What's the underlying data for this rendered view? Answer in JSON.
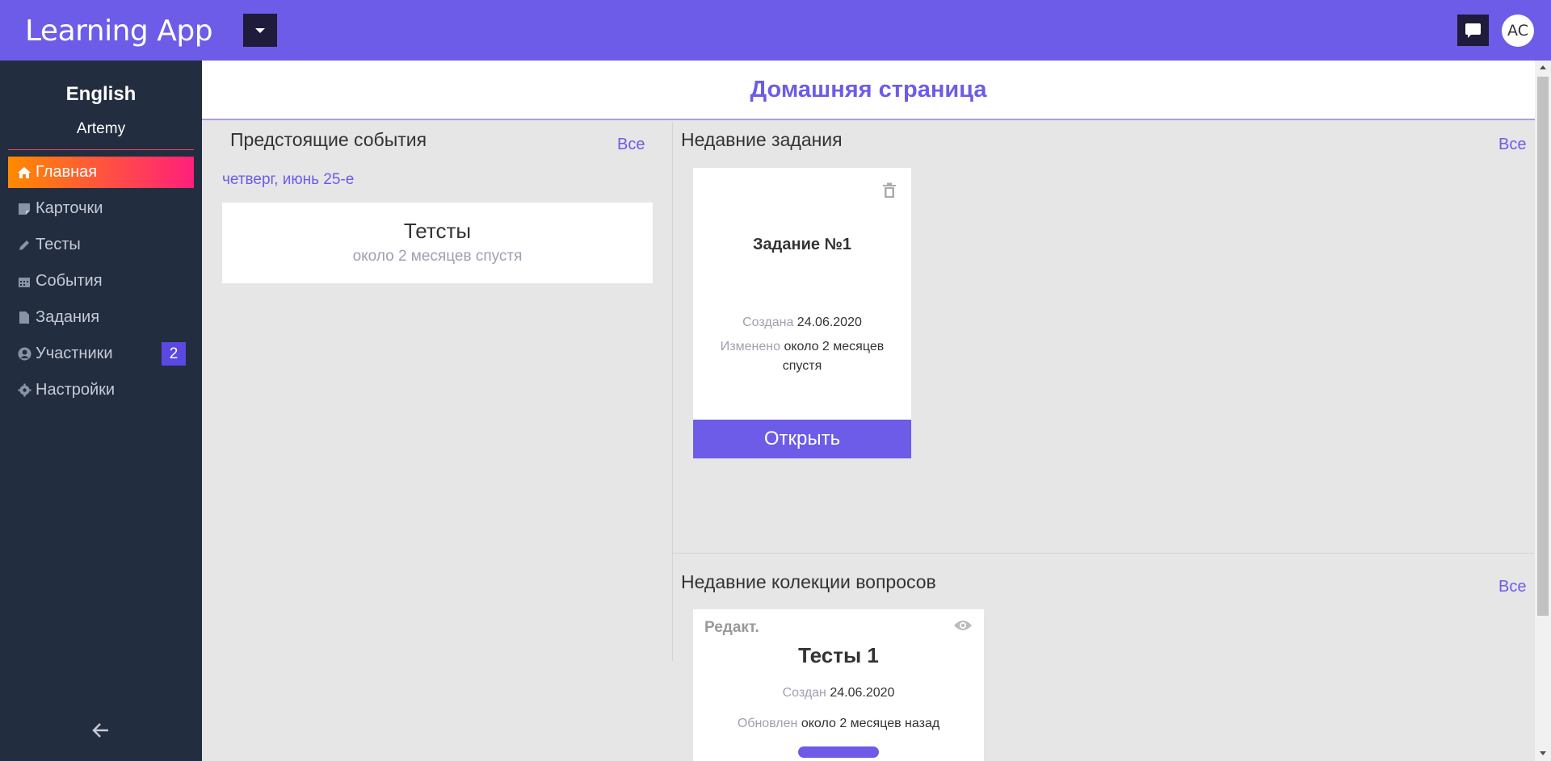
{
  "topbar": {
    "brand": "Learning App",
    "avatar_initials": "AC"
  },
  "sidebar": {
    "course": "English",
    "user": "Artemy",
    "items": [
      {
        "label": "Главная",
        "icon": "home-icon",
        "active": true
      },
      {
        "label": "Карточки",
        "icon": "note-icon"
      },
      {
        "label": "Тесты",
        "icon": "pencil-icon"
      },
      {
        "label": "События",
        "icon": "calendar-icon"
      },
      {
        "label": "Задания",
        "icon": "file-icon"
      },
      {
        "label": "Участники",
        "icon": "user-circle-icon",
        "badge": "2"
      },
      {
        "label": "Настройки",
        "icon": "gear-icon"
      }
    ]
  },
  "page": {
    "title": "Домашняя страница"
  },
  "events": {
    "title": "Предстоящие события",
    "all_label": "Все",
    "date": "четверг, июнь 25-е",
    "items": [
      {
        "name": "Тетсты",
        "time": "около 2 месяцев спустя"
      }
    ]
  },
  "tasks": {
    "title": "Недавние задания",
    "all_label": "Все",
    "items": [
      {
        "name": "Задание №1",
        "created_label": "Создана",
        "created": "24.06.2020",
        "modified_label": "Изменено",
        "modified_1": "около 2 месяцев",
        "modified_2": "спустя",
        "open_label": "Открыть"
      }
    ]
  },
  "collections": {
    "title": "Недавние колекции вопросов",
    "all_label": "Все",
    "items": [
      {
        "edit_label": "Редакт.",
        "name": "Тесты 1",
        "created_label": "Создан",
        "created": "24.06.2020",
        "updated_label": "Обновлен",
        "updated": "около 2 месяцев назад"
      }
    ]
  },
  "colors": {
    "accent": "#6c5ce7",
    "sidebar_bg": "#222d3f",
    "active_gradient_start": "#ff8a00",
    "active_gradient_end": "#ff1f7a"
  }
}
